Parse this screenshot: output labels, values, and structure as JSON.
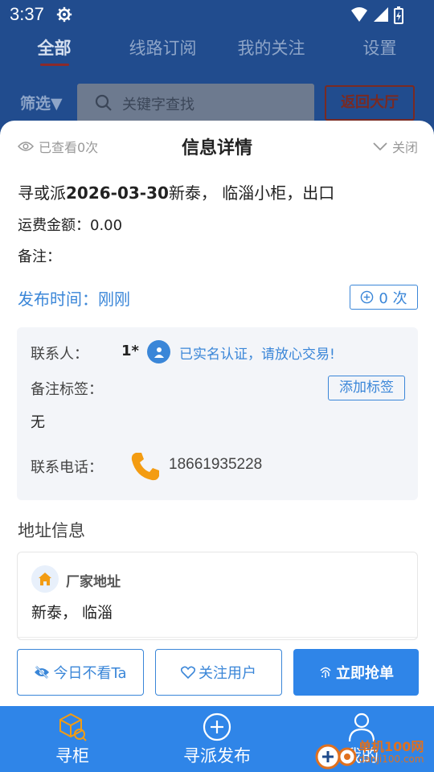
{
  "status": {
    "time": "3:37"
  },
  "top_tabs": [
    {
      "label": "全部",
      "active": true
    },
    {
      "label": "线路订阅",
      "active": false
    },
    {
      "label": "我的关注",
      "active": false
    },
    {
      "label": "设置",
      "active": false
    }
  ],
  "filter": {
    "label": "筛选▼"
  },
  "search": {
    "placeholder": "关键字查找"
  },
  "back_button": {
    "label": "返回大厅"
  },
  "sheet": {
    "viewed": "已查看0次",
    "title": "信息详情",
    "close": "关闭"
  },
  "detail": {
    "route_prefix": "寻或派",
    "route_bold": "2026-03-30",
    "route_suffix": "新泰， 临淄小柜，出口",
    "fee": "运费金额：0.00",
    "note": "备注：",
    "publish_time": "发布时间：刚刚",
    "count": "0 次"
  },
  "contact": {
    "name_label": "联系人：",
    "name_value": "1*",
    "verified_text": "已实名认证，请放心交易!",
    "tag_label": "备注标签：",
    "add_tag": "添加标签",
    "tag_value": "无",
    "phone_label": "联系电话：",
    "phone_value": "18661935228"
  },
  "address": {
    "section_title": "地址信息",
    "label": "厂家地址",
    "value": "新泰， 临淄"
  },
  "actions": {
    "hide_today": "今日不看Ta",
    "follow_user": "关注用户",
    "grab_order": "立即抢单"
  },
  "bottom_nav": [
    {
      "label": "寻柜",
      "icon": "box-search-icon"
    },
    {
      "label": "寻派发布",
      "icon": "plus-circle-icon"
    },
    {
      "label": "我的",
      "icon": "person-icon"
    }
  ],
  "watermark": {
    "text": "单机100网",
    "sub": "danji100.com"
  },
  "colors": {
    "accent": "#2f85e8",
    "link": "#3a86d8",
    "orange": "#f39c12"
  }
}
